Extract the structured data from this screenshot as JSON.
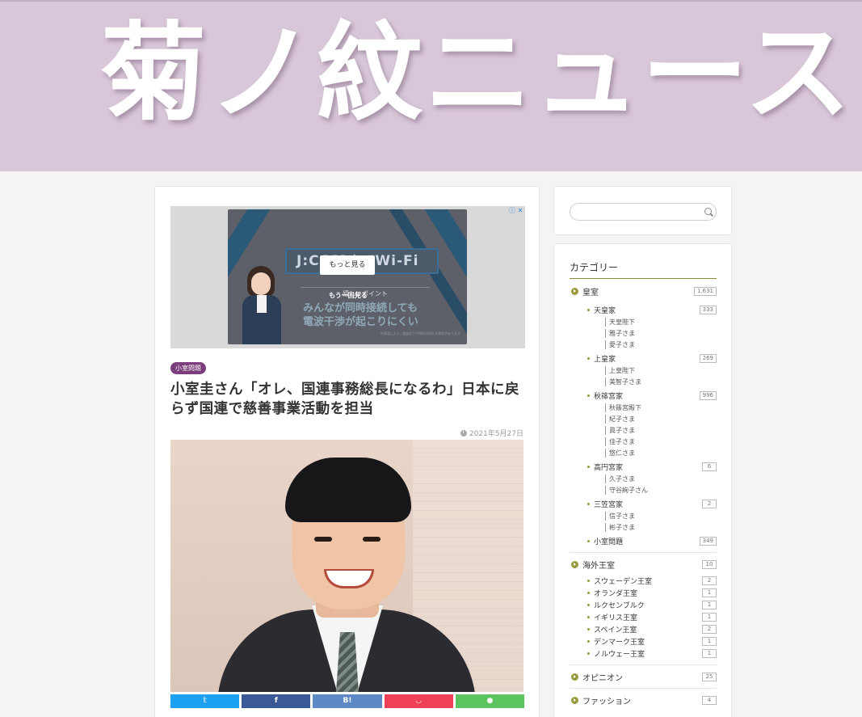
{
  "site": {
    "logo_text": "菊ノ紋ニュース"
  },
  "ad": {
    "brand_text": "J:COM ｼｮﾜWi-Fi",
    "more_label": "もっと見る",
    "point_text": "嬉しいポイント",
    "replay_label": "もう一回見る",
    "line1": "みんなが同時接続しても",
    "line2": "電波干渉が起こりにくい",
    "fine_print": "※環境により、速度低下や接続が切れる場合があります"
  },
  "article": {
    "category": "小室問題",
    "title": "小室圭さん「オレ、国連事務総長になるわ」日本に戻らず国連で慈善事業活動を担当",
    "date": "2021年5月27日",
    "share": {
      "twitter": "𝕥",
      "facebook": "f",
      "hatena": "B!",
      "pocket": "◡",
      "line": "●"
    }
  },
  "sidebar": {
    "search": {
      "placeholder": ""
    },
    "categories_title": "カテゴリー",
    "categories": {
      "koushitsu": {
        "label": "皇室",
        "count": "1,631"
      },
      "tennouke": {
        "label": "天皇家",
        "count": "333"
      },
      "tennouke_subs": [
        "天皇陛下",
        "雅子さま",
        "愛子さま"
      ],
      "joukouke": {
        "label": "上皇家",
        "count": "269"
      },
      "joukouke_subs": [
        "上皇陛下",
        "美智子さま"
      ],
      "akishino": {
        "label": "秋篠宮家",
        "count": "996"
      },
      "akishino_subs": [
        "秋篠宮殿下",
        "紀子さま",
        "眞子さま",
        "佳子さま",
        "悠仁さま"
      ],
      "takamado": {
        "label": "高円宮家",
        "count": "6"
      },
      "takamado_subs": [
        "久子さま",
        "守谷絢子さん"
      ],
      "mikasa": {
        "label": "三笠宮家",
        "count": "2"
      },
      "mikasa_subs": [
        "信子さま",
        "彬子さま"
      ],
      "komuro": {
        "label": "小室問題",
        "count": "349"
      },
      "kaigai": {
        "label": "海外王室",
        "count": "10"
      },
      "kaigai_items": [
        {
          "label": "スウェーデン王室",
          "count": "2"
        },
        {
          "label": "オランダ王室",
          "count": "1"
        },
        {
          "label": "ルクセンブルク",
          "count": "1"
        },
        {
          "label": "イギリス王室",
          "count": "1"
        },
        {
          "label": "スペイン王室",
          "count": "2"
        },
        {
          "label": "デンマーク王室",
          "count": "1"
        },
        {
          "label": "ノルウェー王室",
          "count": "1"
        }
      ],
      "opinion": {
        "label": "オピニオン",
        "count": "25"
      },
      "fashion": {
        "label": "ファッション",
        "count": "4"
      }
    }
  }
}
